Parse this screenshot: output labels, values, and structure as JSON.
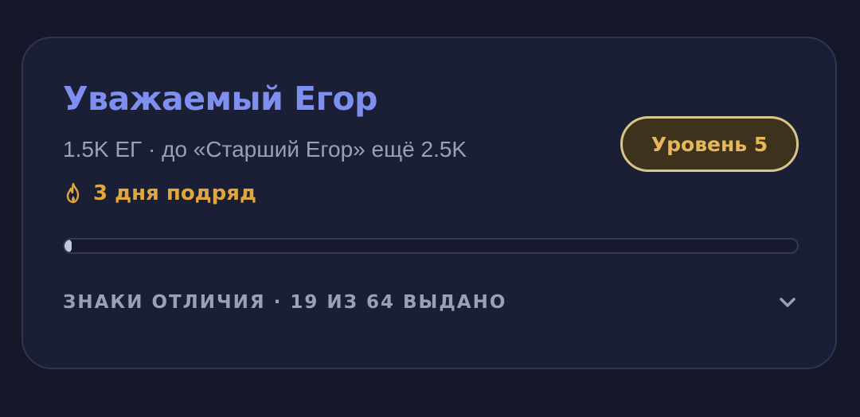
{
  "profile": {
    "title": "Уважаемый Егор",
    "subtitle": "1.5K ЕГ · до «Старший Егор» ещё 2.5K",
    "streak": {
      "icon": "fire-icon",
      "label": "3 дня подряд"
    },
    "level_badge": "Уровень 5",
    "progress": {
      "percent": 1
    },
    "badges_summary": "ЗНАКИ ОТЛИЧИЯ · 19 ИЗ 64 ВЫДАНО",
    "expand_icon": "chevron-down-icon"
  },
  "colors": {
    "background": "#151828",
    "card": "#1b1f36",
    "title": "#7f8ff0",
    "accent_gold": "#e0a83c",
    "muted_text": "#9aa0b8"
  }
}
